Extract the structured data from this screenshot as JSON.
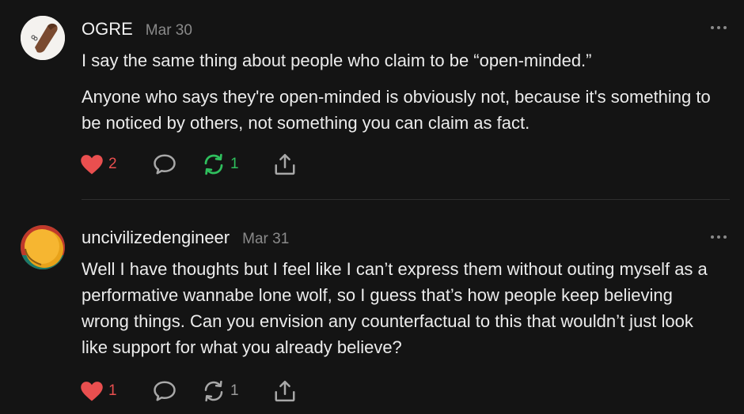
{
  "colors": {
    "background": "#141414",
    "like": "#e94f4f",
    "repost_active": "#2fbf5d",
    "muted": "#8a8a8a"
  },
  "posts": [
    {
      "username": "OGRE",
      "date": "Mar 30",
      "avatar_icon": "brown-shoe-avatar",
      "paragraphs": [
        "I say the same thing about people who claim to be “open-minded.”",
        "Anyone who says they're open-minded is obviously not, because it's something to be noticed by others, not something you can claim as fact."
      ],
      "likes": "2",
      "reposts": "1",
      "liked": true,
      "reposted": true
    },
    {
      "username": "uncivilizedengineer",
      "date": "Mar 31",
      "avatar_icon": "orange-circle-avatar",
      "paragraphs": [
        "Well I have thoughts but I feel like I can’t express them without outing myself as a performative wannabe lone wolf, so I guess that’s how people keep believing wrong things. Can you envision any counterfactual to this that wouldn’t just look like support for what you already believe?"
      ],
      "likes": "1",
      "reposts": "1",
      "liked": true,
      "reposted": false
    }
  ]
}
